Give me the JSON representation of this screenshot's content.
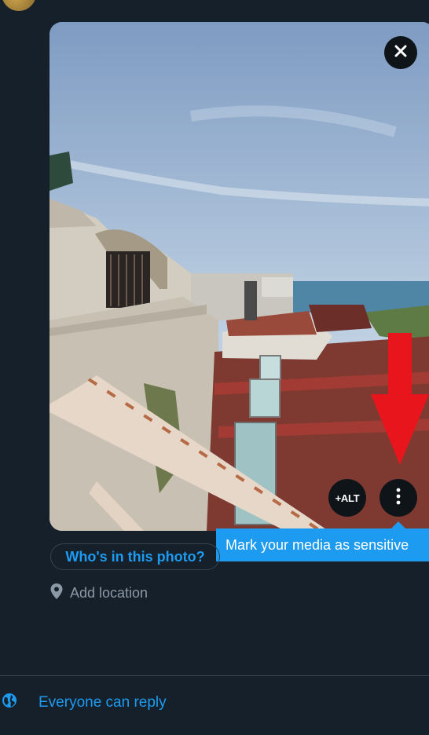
{
  "composer": {
    "tag_people_label": "Who's in this photo?",
    "location_label": "Add location",
    "alt_label": "+ALT",
    "tooltip_text": "Mark your media as sensitive",
    "reply_setting_label": "Everyone can reply"
  },
  "icons": {
    "close": "close-icon",
    "more": "more-vertical-icon",
    "location": "location-pin-icon",
    "globe": "globe-icon",
    "annotation": "red-arrow-annotation"
  },
  "colors": {
    "background": "#16202b",
    "accent": "#1d9bf0",
    "button_bg": "#0f1419",
    "annotation_red": "#e8161c"
  }
}
